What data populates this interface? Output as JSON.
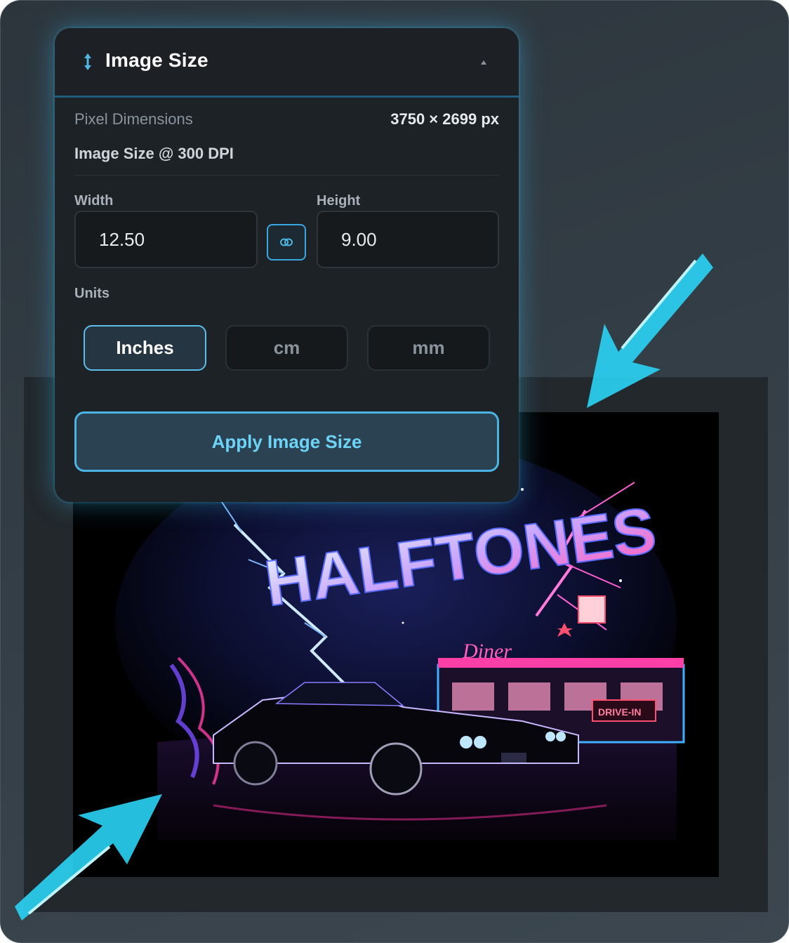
{
  "panel": {
    "title": "Image Size",
    "header_icon": "vertical-resize-arrows-icon",
    "collapse_icon": "triangle-up-icon",
    "pixel_dimensions_label": "Pixel Dimensions",
    "pixel_dimensions_value": "3750 × 2699 px",
    "size_heading": "Image Size @ 300 DPI",
    "width_label": "Width",
    "width_value": "12.50",
    "height_label": "Height",
    "height_value": "9.00",
    "link_icon": "chain-link-icon",
    "units_label": "Units",
    "units": [
      "Inches",
      "cm",
      "mm"
    ],
    "selected_unit": "Inches",
    "apply_label": "Apply Image Size"
  },
  "artwork": {
    "title_text": "HALFTONES",
    "diner_sign": "Diner",
    "drive_in_sign": "DRIVE-IN"
  },
  "colors": {
    "accent": "#5bbde9",
    "apply_text": "#6dd3f7",
    "panel_bg": "#1d2226",
    "frame_bg": "#333d45"
  }
}
